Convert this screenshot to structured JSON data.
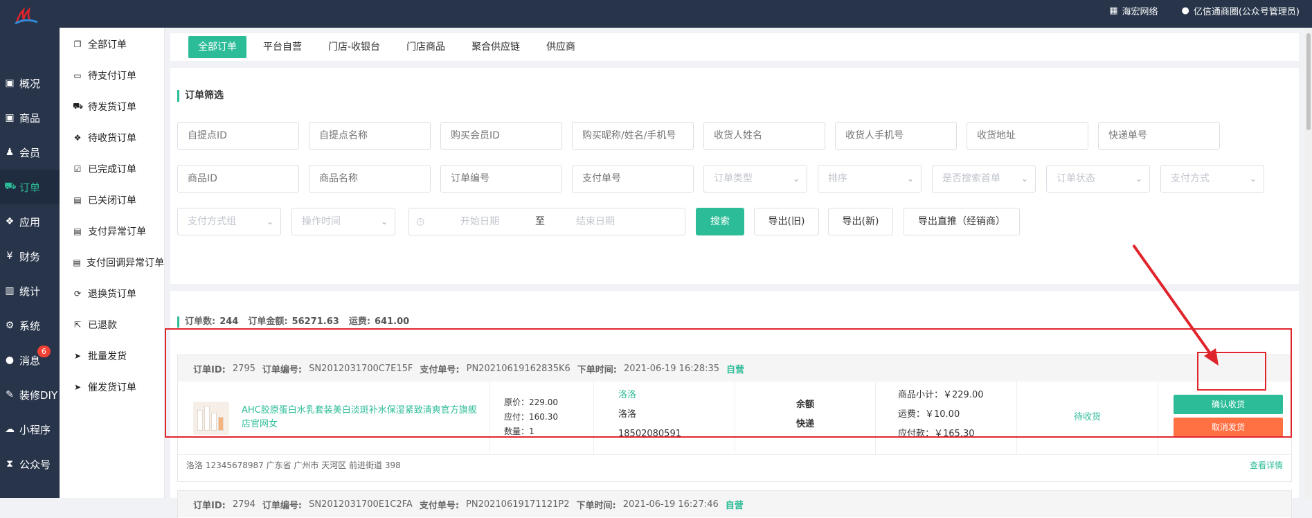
{
  "topbar": {
    "items": [
      {
        "icon": "grid-icon",
        "label": "海宏网络"
      },
      {
        "icon": "user-icon",
        "label": "亿信通商圈(公众号管理员)"
      }
    ]
  },
  "sidebar": {
    "items": [
      {
        "icon": "archive-icon",
        "label": "概况"
      },
      {
        "icon": "box-icon",
        "label": "商品"
      },
      {
        "icon": "users-icon",
        "label": "会员"
      },
      {
        "icon": "cart-icon",
        "label": "订单",
        "active": true
      },
      {
        "icon": "apps-icon",
        "label": "应用"
      },
      {
        "icon": "yen-icon",
        "label": "财务"
      },
      {
        "icon": "bar-chart-icon",
        "label": "统计"
      },
      {
        "icon": "gears-icon",
        "label": "系统"
      },
      {
        "icon": "comment-icon",
        "label": "消息",
        "badge": "6"
      },
      {
        "icon": "wrench-icon",
        "label": "装修DIY"
      },
      {
        "icon": "wechat-icon",
        "label": "小程序"
      },
      {
        "icon": "hourglass-icon",
        "label": "公众号"
      }
    ]
  },
  "submenu": {
    "items": [
      {
        "icon": "copy-icon",
        "label": "全部订单"
      },
      {
        "icon": "credit-card-icon",
        "label": "待支付订单"
      },
      {
        "icon": "truck-icon",
        "label": "待发货订单"
      },
      {
        "icon": "dropbox-icon",
        "label": "待收货订单"
      },
      {
        "icon": "check-square-icon",
        "label": "已完成订单"
      },
      {
        "icon": "trash-icon",
        "label": "已关闭订单"
      },
      {
        "icon": "trash-icon",
        "label": "支付异常订单"
      },
      {
        "icon": "trash-icon",
        "label": "支付回调异常订单"
      },
      {
        "icon": "refresh-icon",
        "label": "退换货订单"
      },
      {
        "icon": "external-icon",
        "label": "已退款"
      },
      {
        "icon": "send-icon",
        "label": "批量发货"
      },
      {
        "icon": "send-icon",
        "label": "催发货订单"
      }
    ]
  },
  "tabs": [
    "全部订单",
    "平台自营",
    "门店-收银台",
    "门店商品",
    "聚合供应链",
    "供应商"
  ],
  "filter": {
    "title": "订单筛选",
    "row1": [
      "自提点ID",
      "自提点名称",
      "购买会员ID",
      "购买昵称/姓名/手机号",
      "收货人姓名",
      "收货人手机号",
      "收货地址",
      "快递单号"
    ],
    "row2_inputs": [
      "商品ID",
      "商品名称",
      "订单编号",
      "支付单号"
    ],
    "row2_selects": [
      "订单类型",
      "排序",
      "是否搜索首单",
      "订单状态",
      "支付方式"
    ],
    "row3_selects": [
      "支付方式组",
      "操作时间"
    ],
    "date_start": "开始日期",
    "date_sep": "至",
    "date_end": "结束日期",
    "buttons": {
      "search": "搜索",
      "export_old": "导出(旧)",
      "export_new": "导出(新)",
      "export_direct": "导出直推（经销商）"
    }
  },
  "summary": {
    "count_label": "订单数:",
    "count": "244",
    "amount_label": "订单金额:",
    "amount": "56271.63",
    "freight_label": "运费:",
    "freight": "641.00"
  },
  "orders": [
    {
      "id_label": "订单ID:",
      "id": "2795",
      "sn_label": "订单编号:",
      "sn": "SN2012031700C7E15F",
      "pay_label": "支付单号:",
      "pay_no": "PN20210619162835K6",
      "time_label": "下单时间:",
      "time": "2021-06-19 16:28:35",
      "tag": "自营",
      "product": "AHC胶原蛋白水乳套装美白淡斑补水保湿紧致清爽官方旗舰店官网女",
      "original_price": "原价：229.00",
      "payable": "应付：160.30",
      "quantity": "数量：1",
      "buyer_nick": "洛洛",
      "buyer_name": "洛洛",
      "buyer_phone": "18502080591",
      "pay_method": "余额",
      "ship_method": "快递",
      "subtotal": "商品小计：￥229.00",
      "shipping": "运费：￥10.00",
      "total": "应付款：￥165.30",
      "status": "待收货",
      "confirm_btn": "确认收货",
      "cancel_btn": "取消发货",
      "address": "洛洛   12345678987   广东省 广州市 天河区 前进街道 398",
      "detail_link": "查看详情"
    },
    {
      "id_label": "订单ID:",
      "id": "2794",
      "sn_label": "订单编号:",
      "sn": "SN2012031700E1C2FA",
      "pay_label": "支付单号:",
      "pay_no": "PN20210619171121P2",
      "time_label": "下单时间:",
      "time": "2021-06-19 16:27:46",
      "tag": "自营"
    }
  ],
  "colors": {
    "accent": "#2cbc98",
    "dark": "#27344a",
    "danger": "#ff7043",
    "annotation": "#e0242c"
  }
}
